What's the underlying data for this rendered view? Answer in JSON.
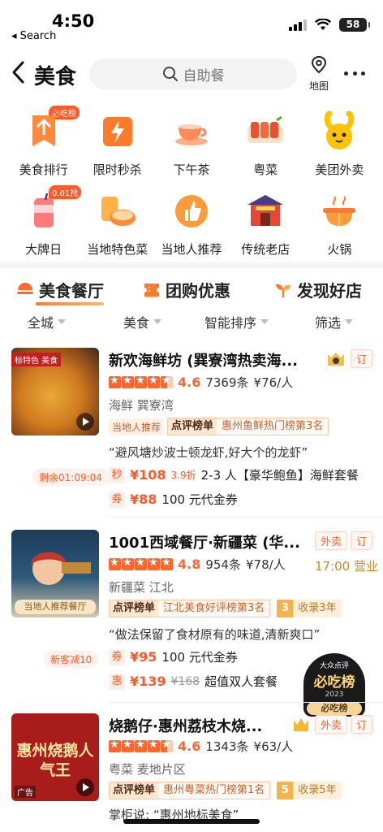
{
  "status": {
    "time": "4:50",
    "back_app": "◂ Search",
    "battery": "58"
  },
  "header": {
    "title": "美食",
    "search_placeholder": "自助餐",
    "map_label": "地图"
  },
  "categories": [
    {
      "label": "美食排行",
      "tag": "必吃榜"
    },
    {
      "label": "限时秒杀"
    },
    {
      "label": "下午茶"
    },
    {
      "label": "粤菜"
    },
    {
      "label": "美团外卖"
    },
    {
      "label": "大牌日",
      "tag": "0.01抢"
    },
    {
      "label": "当地特色菜"
    },
    {
      "label": "当地人推荐"
    },
    {
      "label": "传统老店"
    },
    {
      "label": "火锅"
    }
  ],
  "tabs": [
    {
      "label": "美食餐厅"
    },
    {
      "label": "团购优惠"
    },
    {
      "label": "发现好店"
    }
  ],
  "filters": [
    "全城",
    "美食",
    "智能排序",
    "筛选"
  ],
  "listings": [
    {
      "name": "新欢海鲜坊 (巽寮湾热卖海...",
      "score": "4.6",
      "reviews": "7369条",
      "price": "¥76/人",
      "area": "海鲜  巽寮湾",
      "local_badge": "当地人推荐",
      "pick_key": "点评榜单",
      "pick_val": "惠州鱼鲜热门榜第3名",
      "quote": "“避风塘炒波士顿龙虾,好大个的龙虾”",
      "reserve": "订",
      "timer": "剩余01:09:04",
      "deal1": {
        "kind": "秒",
        "price": "¥108",
        "discount": "3.9折",
        "text": "2-3 人【豪华鲍鱼】海鲜套餐"
      },
      "deal2": {
        "kind": "券",
        "price": "¥88",
        "text": "100 元代金券"
      },
      "thumb_label": "标特色 美食"
    },
    {
      "name": "1001西域餐厅·新疆菜 (华...",
      "score": "4.8",
      "reviews": "954条",
      "price": "¥78/人",
      "area": "新疆菜  江北",
      "open": "17:00 营业",
      "pick_key": "点评榜单",
      "pick_val": "江北美食好评榜第3名",
      "year_num": "3",
      "year_text": "收录3年",
      "quote": "“做法保留了食材原有的味道,清新爽口”",
      "takeout": "外卖",
      "reserve": "订",
      "newcomer": "新客减10",
      "deal1": {
        "kind": "券",
        "price": "¥95",
        "text": "100 元代金券"
      },
      "deal2": {
        "kind": "惠",
        "price": "¥139",
        "orig": "¥168",
        "text": "超值双人套餐"
      },
      "thumb_label": "当地人推荐餐厅",
      "seal_top": "大众点评",
      "seal_main": "必吃榜",
      "seal_year": "2023",
      "seal_bottom": "必吃榜"
    },
    {
      "name": "烧鹅仔·惠州荔枝木烧...",
      "score": "4.6",
      "reviews": "1343条",
      "price": "¥63/人",
      "area": "粤菜  麦地片区",
      "pick_key": "点评榜单",
      "pick_val": "惠州粤菜热门榜第1名",
      "year_num": "5",
      "year_text": "收录5年",
      "quote": "掌柜说: “惠州地标美食”",
      "takeout": "外卖",
      "reserve": "订",
      "thumb_text": "惠州烧鹅人气王",
      "ad": "广告"
    }
  ],
  "colors": {
    "accent": "#ff6633",
    "brand_yellow": "#ffc300"
  }
}
